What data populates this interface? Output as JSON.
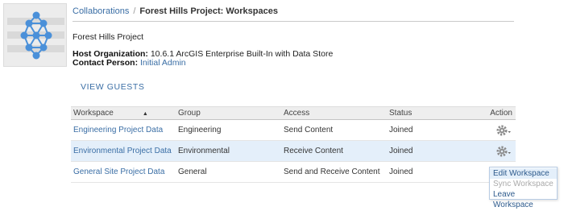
{
  "breadcrumb": {
    "root": "Collaborations",
    "separator": "/",
    "current": "Forest Hills Project: Workspaces"
  },
  "project": {
    "name": "Forest Hills Project",
    "host_label": "Host Organization:",
    "host_value": "10.6.1 ArcGIS Enterprise Built-In with Data Store",
    "contact_label": "Contact Person:",
    "contact_value": "Initial Admin"
  },
  "view_guests": "VIEW GUESTS",
  "table": {
    "headers": {
      "workspace": "Workspace",
      "group": "Group",
      "access": "Access",
      "status": "Status",
      "action": "Action"
    },
    "rows": [
      {
        "workspace": "Engineering Project Data",
        "group": "Engineering",
        "access": "Send Content",
        "status": "Joined"
      },
      {
        "workspace": "Environmental Project Data",
        "group": "Environmental",
        "access": "Receive Content",
        "status": "Joined"
      },
      {
        "workspace": "General Site Project Data",
        "group": "General",
        "access": "Send and Receive Content",
        "status": "Joined"
      }
    ]
  },
  "action_menu": {
    "items": [
      "Edit Workspace",
      "Sync Workspace",
      "Leave Workspace"
    ]
  },
  "icons": {
    "thumbnail": "collaboration-network-icon",
    "sort": "sort-ascending-icon",
    "action": "gear-dropdown-icon"
  },
  "colors": {
    "link": "#3a6ea5",
    "highlight_row": "#e4effa",
    "network_node": "#4a90d9"
  }
}
